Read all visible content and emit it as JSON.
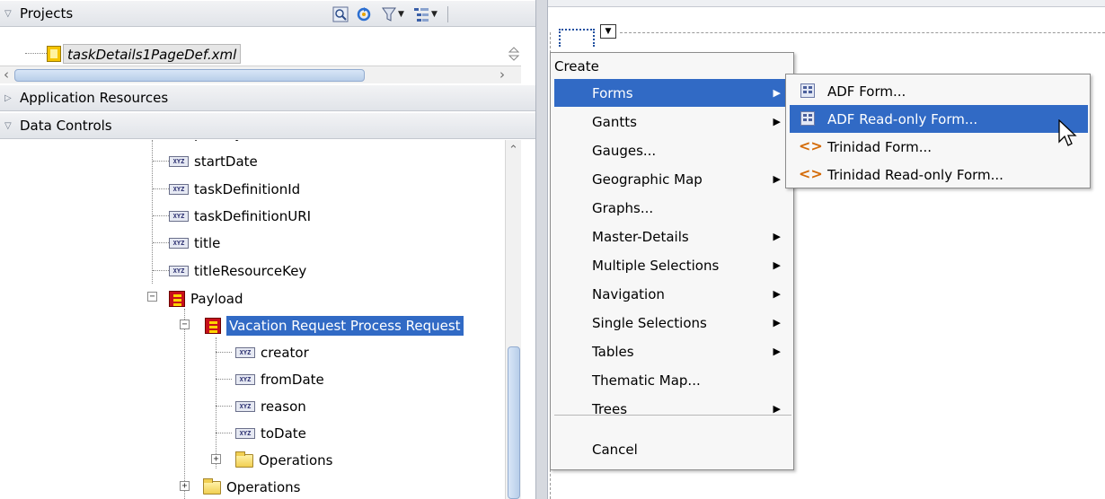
{
  "projects_panel": {
    "title": "Projects",
    "file_name": "taskDetails1PageDef.xml"
  },
  "application_resources": {
    "title": "Application Resources"
  },
  "data_controls": {
    "title": "Data Controls",
    "partial_label": "priority",
    "items": [
      {
        "label": "startDate"
      },
      {
        "label": "taskDefinitionId"
      },
      {
        "label": "taskDefinitionURI"
      },
      {
        "label": "title"
      },
      {
        "label": "titleResourceKey"
      }
    ],
    "payload": {
      "label": "Payload"
    },
    "selected": {
      "label": "Vacation Request Process Request"
    },
    "children": [
      {
        "label": "creator"
      },
      {
        "label": "fromDate"
      },
      {
        "label": "reason"
      },
      {
        "label": "toDate"
      }
    ],
    "inner_operations": {
      "label": "Operations"
    },
    "outer_operations": {
      "label": "Operations"
    },
    "xyz_icon_text": "XYZ"
  },
  "context_menu": {
    "header": "Create",
    "items": [
      {
        "label": "Forms",
        "submenu": true,
        "active": true
      },
      {
        "label": "Gantts",
        "submenu": true
      },
      {
        "label": "Gauges...",
        "submenu": false
      },
      {
        "label": "Geographic Map",
        "submenu": true
      },
      {
        "label": "Graphs...",
        "submenu": false
      },
      {
        "label": "Master-Details",
        "submenu": true
      },
      {
        "label": "Multiple Selections",
        "submenu": true
      },
      {
        "label": "Navigation",
        "submenu": true
      },
      {
        "label": "Single Selections",
        "submenu": true
      },
      {
        "label": "Tables",
        "submenu": true
      },
      {
        "label": "Thematic Map...",
        "submenu": false
      },
      {
        "label": "Trees",
        "submenu": true
      }
    ],
    "cancel": "Cancel"
  },
  "submenu": {
    "items": [
      {
        "label": "ADF Form...",
        "icon": "adf-form-icon"
      },
      {
        "label": "ADF Read-only Form...",
        "icon": "adf-form-icon",
        "active": true
      },
      {
        "label": "Trinidad Form...",
        "icon": "trinidad-icon"
      },
      {
        "label": "Trinidad Read-only Form...",
        "icon": "trinidad-icon"
      }
    ]
  },
  "colors": {
    "selection": "#316ac5",
    "menu_bg": "#f7f7f7",
    "panel_header": "#e1e4e9"
  }
}
